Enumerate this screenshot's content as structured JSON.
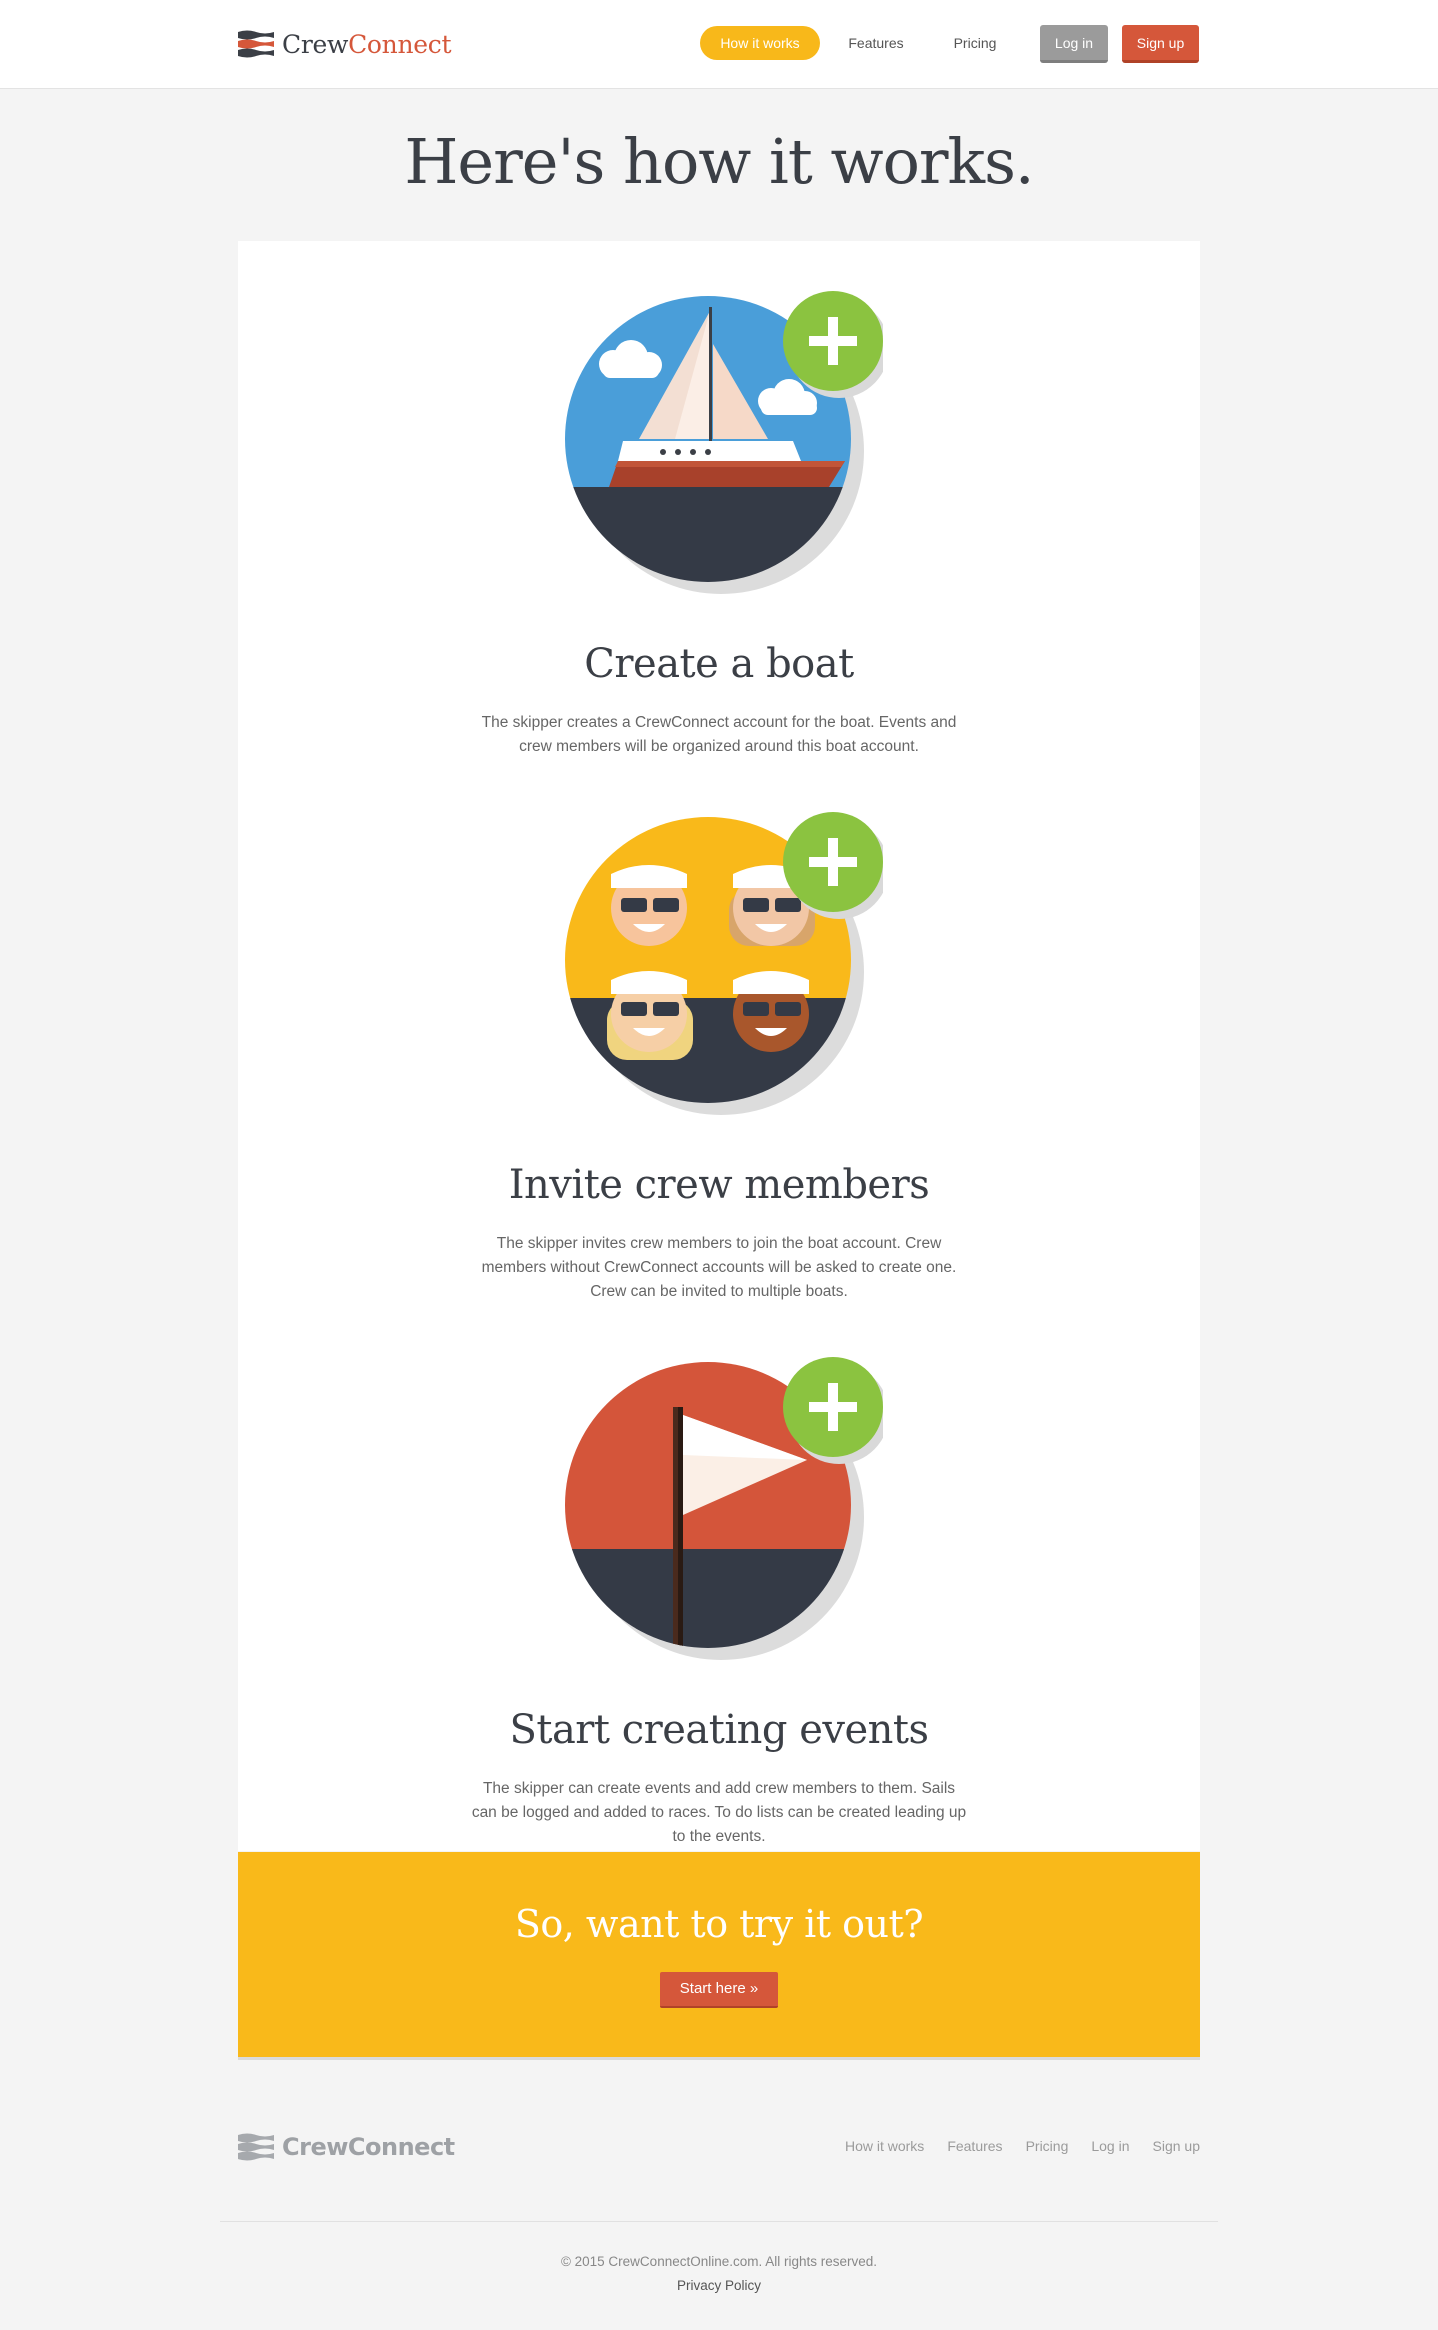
{
  "header": {
    "logo": {
      "crew": "Crew",
      "connect": "Connect"
    },
    "nav": [
      {
        "label": "How it works",
        "active": true
      },
      {
        "label": "Features",
        "active": false
      },
      {
        "label": "Pricing",
        "active": false
      }
    ],
    "login_label": "Log in",
    "signup_label": "Sign up"
  },
  "page_title": "Here's how it works.",
  "steps": [
    {
      "title": "Create a boat",
      "description": "The skipper creates a CrewConnect account for the boat. Events and crew members will be organized around this boat account.",
      "icon": "sailboat-icon"
    },
    {
      "title": "Invite crew members",
      "description": "The skipper invites crew members to join the boat account. Crew members without CrewConnect accounts will be asked to create one. Crew can be invited to multiple boats.",
      "icon": "crew-faces-icon"
    },
    {
      "title": "Start creating events",
      "description": "The skipper can create events and add crew members to them. Sails can be logged and added to races. To do lists can be created leading up to the events.",
      "icon": "flag-icon"
    }
  ],
  "cta": {
    "heading": "So, want to try it out?",
    "button_label": "Start here »"
  },
  "footer": {
    "logo": "CrewConnect",
    "links": [
      "How it works",
      "Features",
      "Pricing",
      "Log in",
      "Sign up"
    ],
    "copyright": "© 2015 CrewConnectOnline.com. All rights reserved.",
    "privacy": "Privacy Policy"
  },
  "colors": {
    "accent_yellow": "#f9b91a",
    "accent_orange": "#d5573a",
    "plus_green": "#8bc340",
    "dark_navy": "#343a46"
  }
}
